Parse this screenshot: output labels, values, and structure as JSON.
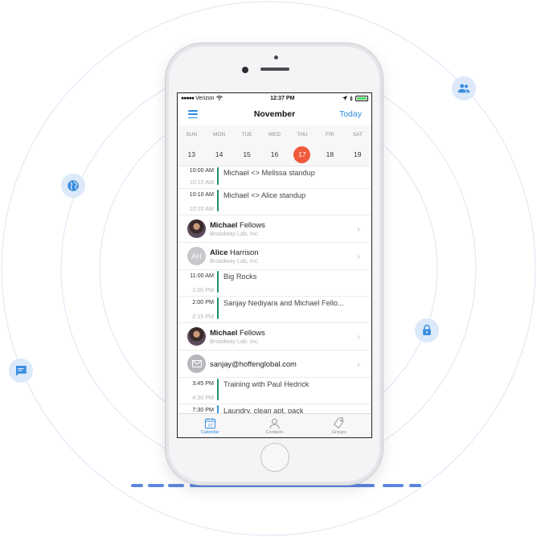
{
  "colors": {
    "accent": "#2d8bde",
    "selected_date": "#ef5a3b",
    "event_green": "#1e8f6e",
    "event_blue": "#3a9ad9",
    "icon_bg": "#dbe9f9"
  },
  "floating_icons": [
    "users-icon",
    "globe-icon",
    "lock-icon",
    "chat-icon"
  ],
  "status_bar": {
    "carrier": "Verizon",
    "time": "12:37 PM"
  },
  "header": {
    "menu_icon": "hamburger-menu-icon",
    "title": "November",
    "today_label": "Today"
  },
  "calendar": {
    "weekdays": [
      "SUN",
      "MON",
      "TUE",
      "WED",
      "THU",
      "FRI",
      "SAT"
    ],
    "dates": [
      "13",
      "14",
      "15",
      "16",
      "17",
      "18",
      "19"
    ],
    "selected": "17"
  },
  "items": [
    {
      "type": "event",
      "start": "10:00 AM",
      "end": "10:10 AM",
      "title": "Michael <> Melissa standup"
    },
    {
      "type": "event",
      "start": "10:10 AM",
      "end": "10:20 AM",
      "title": "Michael <> Alice standup"
    },
    {
      "type": "contact",
      "first": "Michael",
      "last": " Fellows",
      "org": "Broadway Lab, Inc.",
      "avatar": "photo"
    },
    {
      "type": "contact",
      "first": "Alice",
      "last": " Harrison",
      "org": "Broadway Lab, Inc.",
      "avatar": "initials",
      "initials": "AH"
    },
    {
      "type": "event",
      "start": "11:00 AM",
      "end": "1:00 PM",
      "title": "Big Rocks"
    },
    {
      "type": "event",
      "start": "2:00 PM",
      "end": "2:15 PM",
      "title": "Sanjay Nediyara and Michael Fello..."
    },
    {
      "type": "contact",
      "first": "Michael",
      "last": " Fellows",
      "org": "Broadway Lab, Inc.",
      "avatar": "photo"
    },
    {
      "type": "email",
      "email": "sanjay@hoffenglobal.com"
    },
    {
      "type": "event",
      "start": "3:45 PM",
      "end": "4:30 PM",
      "title": "Training with Paul Hedrick"
    },
    {
      "type": "event",
      "start": "7:30 PM",
      "end": "",
      "title": "Laundry, clean apt, pack"
    }
  ],
  "tabs": [
    {
      "label": "Calendar",
      "icon": "calendar-icon",
      "icon_text": "17",
      "active": true
    },
    {
      "label": "Contacts",
      "icon": "contacts-icon",
      "active": false
    },
    {
      "label": "Groups",
      "icon": "tag-icon",
      "active": false
    }
  ]
}
